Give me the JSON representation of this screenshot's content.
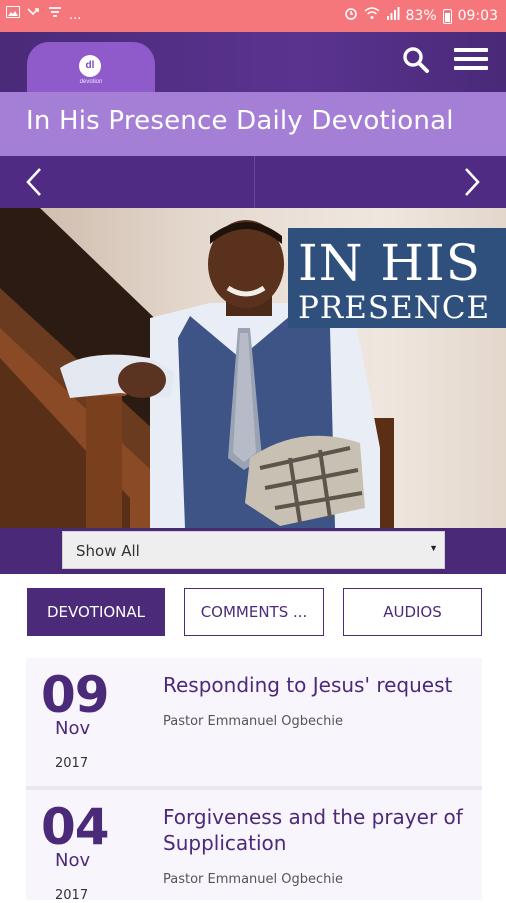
{
  "status_bar": {
    "left_dots": "...",
    "battery_percent": "83%",
    "time": "09:03"
  },
  "header": {
    "logo_text": "dl",
    "logo_subtext": "devotion"
  },
  "title": "In His Presence Daily Devotional",
  "hero": {
    "banner_line1": "IN HIS",
    "banner_line2": "PRESENCE"
  },
  "filter": {
    "selected": "Show All"
  },
  "tabs": [
    {
      "label": "DEVOTIONAL",
      "active": true
    },
    {
      "label": "COMMENTS ...",
      "active": false
    },
    {
      "label": "AUDIOS",
      "active": false
    }
  ],
  "devotionals": [
    {
      "day": "09",
      "month": "Nov",
      "year": "2017",
      "title": "Responding to Jesus' request",
      "author": "Pastor Emmanuel Ogbechie"
    },
    {
      "day": "04",
      "month": "Nov",
      "year": "2017",
      "title": "Forgiveness and the prayer of Supplication",
      "author": "Pastor Emmanuel Ogbechie"
    }
  ],
  "colors": {
    "status_bar": "#f5777c",
    "brand_dark": "#4b2a79",
    "brand_light": "#a57fd6",
    "accent": "#8f5ac9"
  }
}
